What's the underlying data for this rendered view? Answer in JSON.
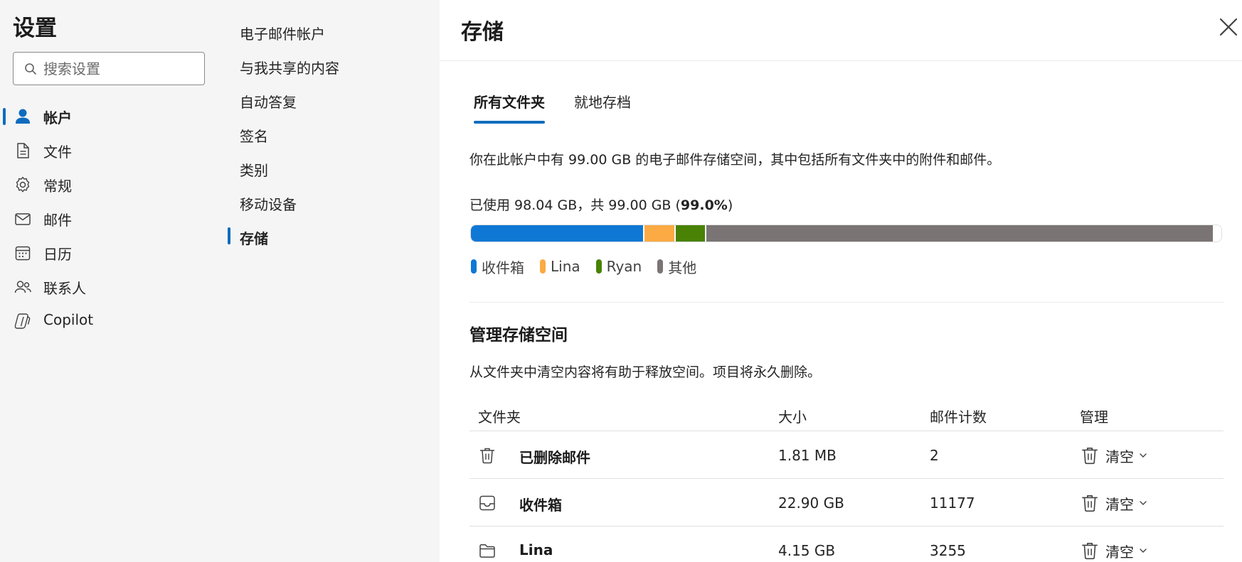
{
  "nav": {
    "title": "设置",
    "search_placeholder": "搜索设置",
    "items": [
      {
        "label": "帐户",
        "icon": "person-icon",
        "active": true
      },
      {
        "label": "文件",
        "icon": "document-icon",
        "active": false
      },
      {
        "label": "常规",
        "icon": "gear-icon",
        "active": false
      },
      {
        "label": "邮件",
        "icon": "mail-icon",
        "active": false
      },
      {
        "label": "日历",
        "icon": "calendar-icon",
        "active": false
      },
      {
        "label": "联系人",
        "icon": "people-icon",
        "active": false
      },
      {
        "label": "Copilot",
        "icon": "copilot-icon",
        "active": false
      }
    ]
  },
  "subnav": {
    "items": [
      {
        "label": "电子邮件帐户",
        "active": false
      },
      {
        "label": "与我共享的内容",
        "active": false
      },
      {
        "label": "自动答复",
        "active": false
      },
      {
        "label": "签名",
        "active": false
      },
      {
        "label": "类别",
        "active": false
      },
      {
        "label": "移动设备",
        "active": false
      },
      {
        "label": "存储",
        "active": true
      }
    ]
  },
  "main": {
    "title": "存储",
    "close_icon": "close-icon",
    "tabs": [
      {
        "label": "所有文件夹",
        "active": true
      },
      {
        "label": "就地存档",
        "active": false
      }
    ],
    "description": "你在此帐户中有 99.00 GB 的电子邮件存储空间，其中包括所有文件夹中的附件和邮件。",
    "usage": {
      "prefix": "已使用 98.04 GB，共 99.00 GB (",
      "percent": "99.0%",
      "suffix": ")",
      "percent_value": 99.0
    },
    "storage_bar": [
      {
        "name": "收件箱",
        "gb": 22.9,
        "color": "#0f78d4"
      },
      {
        "name": "Lina",
        "gb": 4.15,
        "color": "#fbaa44"
      },
      {
        "name": "Ryan",
        "gb": 4.0,
        "color": "#498205"
      },
      {
        "name": "其他",
        "gb": 66.99,
        "color": "#7a7574"
      }
    ],
    "total_gb": 99.0,
    "manage": {
      "title": "管理存储空间",
      "description": "从文件夹中清空内容将有助于释放空间。项目将永久删除。",
      "columns": {
        "folder": "文件夹",
        "size": "大小",
        "count": "邮件计数",
        "manage": "管理"
      },
      "rows": [
        {
          "icon": "trash-icon",
          "name": "已删除邮件",
          "size": "1.81 MB",
          "count": "2",
          "action": "清空"
        },
        {
          "icon": "inbox-icon",
          "name": "收件箱",
          "size": "22.90 GB",
          "count": "11177",
          "action": "清空"
        },
        {
          "icon": "folder-icon",
          "name": "Lina",
          "size": "4.15 GB",
          "count": "3255",
          "action": "清空"
        }
      ]
    }
  }
}
